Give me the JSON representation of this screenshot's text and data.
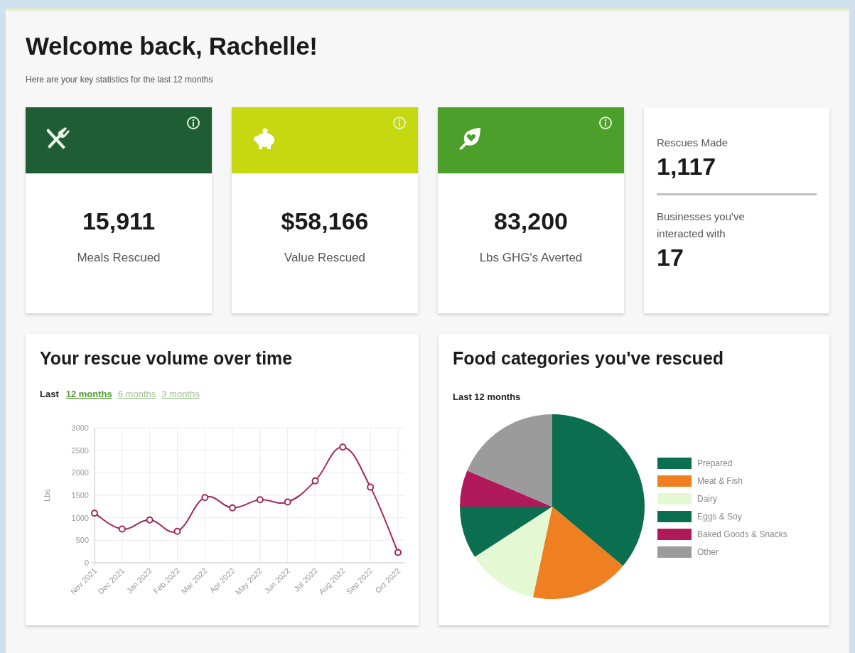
{
  "heading": "Welcome back, Rachelle!",
  "subheading": "Here are your key statistics for the last 12 months",
  "stat_cards": [
    {
      "kind": "meals",
      "color": "#1f5e34",
      "value": "15,911",
      "label": "Meals Rescued"
    },
    {
      "kind": "money",
      "color": "#c6d80f",
      "value": "$58,166",
      "label": "Value Rescued"
    },
    {
      "kind": "leaf",
      "color": "#4d9f2c",
      "value": "83,200",
      "label": "Lbs GHG's Averted"
    }
  ],
  "summary_card": {
    "items": [
      {
        "label": "Rescues Made",
        "value": "1,117"
      },
      {
        "label": "Businesses you've interacted with",
        "value": "17"
      }
    ]
  },
  "volume_panel": {
    "title": "Your rescue volume over time",
    "range_label": "Last",
    "range_tabs": [
      {
        "label": "12 months",
        "selected": true
      },
      {
        "label": "6 months",
        "selected": false
      },
      {
        "label": "3 months",
        "selected": false
      }
    ],
    "chart_data": {
      "type": "line",
      "ylabel": "Lbs",
      "categories": [
        "Nov 2021",
        "Dec 2021",
        "Jan 2022",
        "Feb 2022",
        "Mar 2022",
        "Apr 2022",
        "May 2022",
        "Jun 2022",
        "Jul 2022",
        "Aug 2022",
        "Sep 2022",
        "Oct 2022"
      ],
      "grid": true,
      "series": [
        {
          "color": "#a0285a",
          "marker": true,
          "values": [
            1100,
            750,
            950,
            700,
            1450,
            1220,
            1400,
            1350,
            1820,
            2570,
            1680,
            230
          ]
        }
      ],
      "ylim": [
        0,
        3000
      ],
      "yticks": [
        0,
        500,
        1000,
        1500,
        2000,
        2500,
        3000
      ]
    }
  },
  "categories_panel": {
    "title": "Food categories you've rescued",
    "subtitle": "Last 12 months",
    "legend": [
      {
        "label": "Prepared",
        "color": "#0b6e4f"
      },
      {
        "label": "Meat & Fish",
        "color": "#ef8022"
      },
      {
        "label": "Dairy",
        "color": "#e4f8d4"
      },
      {
        "label": "Eggs & Soy",
        "color": "#0b6e4f"
      },
      {
        "label": "Baked Goods & Snacks",
        "color": "#b0195a"
      },
      {
        "label": "Other",
        "color": "#9b9b9b"
      }
    ]
  }
}
